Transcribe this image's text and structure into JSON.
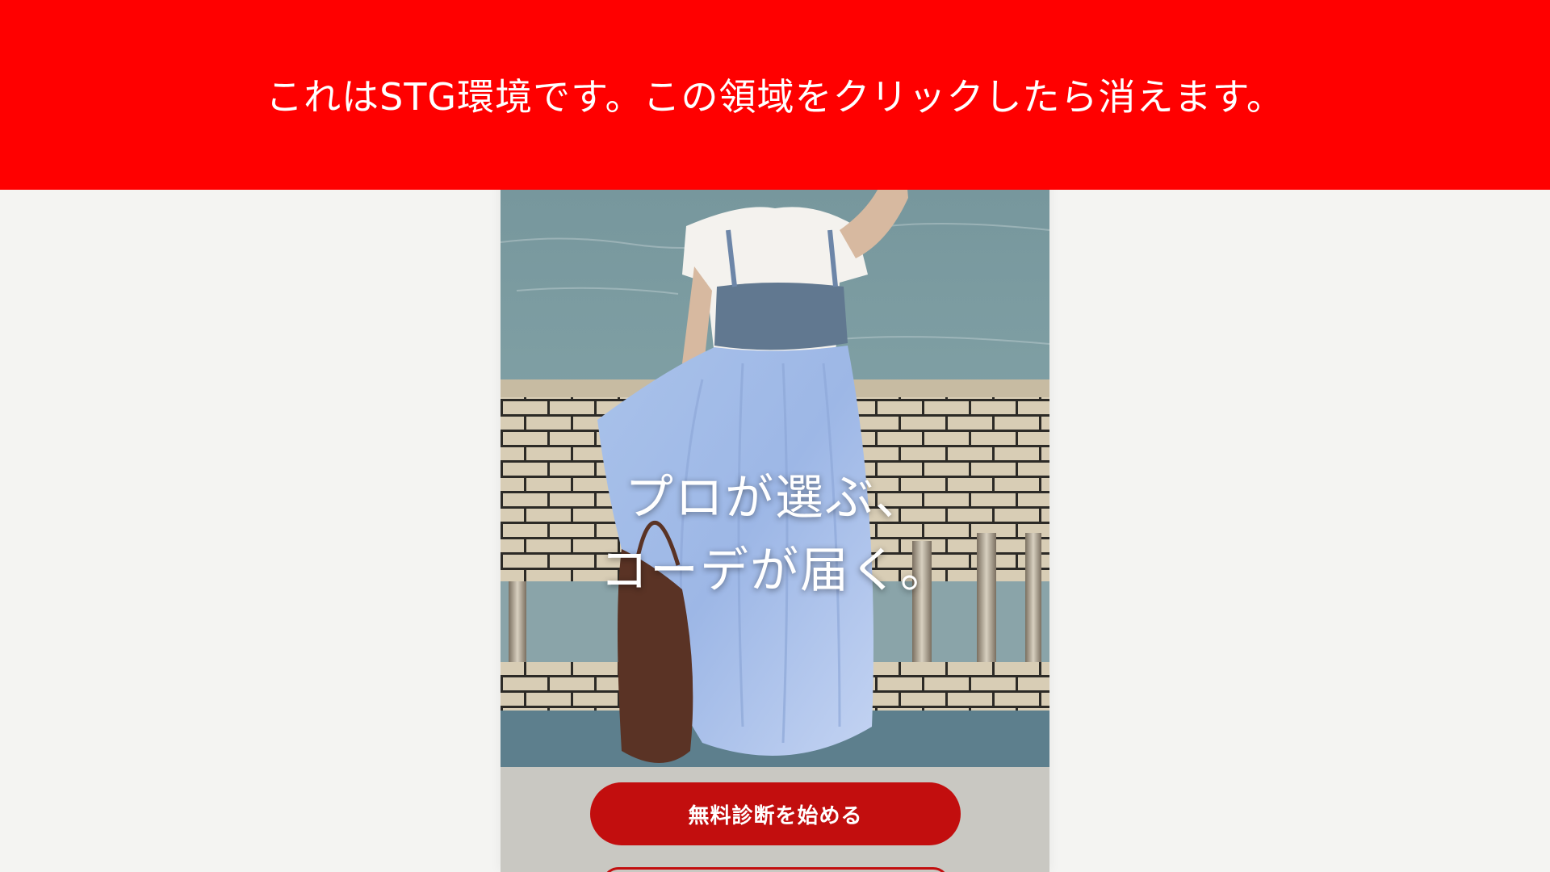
{
  "stg_banner": {
    "message": "これはSTG環境です。この領域をクリックしたら消えます。",
    "background": "#ff0000"
  },
  "hero": {
    "headline_line1": "プロが選ぶ、",
    "headline_line2": "コーデが届く。",
    "cta_label": "無料診断を始める",
    "cta_color": "#c20e0e"
  },
  "page": {
    "background": "#f4f4f2"
  }
}
